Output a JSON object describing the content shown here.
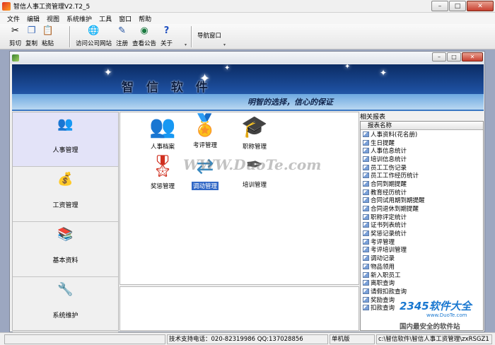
{
  "window": {
    "title": "智信人事工资管理V2.T2_5",
    "minimize": "–",
    "maximize": "□",
    "close": "✕"
  },
  "menu": [
    "文件",
    "编辑",
    "视图",
    "系统维护",
    "工具",
    "窗口",
    "帮助"
  ],
  "toolbar": {
    "cut": "剪切",
    "copy": "复制",
    "paste": "粘贴",
    "visit_site": "访问公司网站",
    "register": "注册",
    "notice": "查看公告",
    "about": "关于",
    "nav_window": "导航窗口"
  },
  "child_window": {
    "minimize": "–",
    "maximize": "□",
    "close": "✕"
  },
  "banner": {
    "brand": "智 信 软 件",
    "slogan": "明智的选择，信心的保证"
  },
  "leftnav": [
    "人事管理",
    "工资管理",
    "基本资料",
    "系统维护"
  ],
  "modules": [
    "人事档案",
    "考评管理",
    "职称管理",
    "奖惩管理",
    "调动管理",
    "培训管理"
  ],
  "watermark": "WWW.DuoTe.com",
  "reports": {
    "heading": "相关报表",
    "column": "报表名称",
    "items": [
      "人事资料(花名册)",
      "生日提醒",
      "人事信息统计",
      "培训信息统计",
      "员工工伤记录",
      "员工工作经历统计",
      "合同到期提醒",
      "教育经历统计",
      "合同试用期到期提醒",
      "合同退休到期提醒",
      "职称评定统计",
      "证书列表统计",
      "奖惩记录统计",
      "考评管理",
      "考评培训管理",
      "调动记录",
      "物品领用",
      "新入职员工",
      "离职查询",
      "请假扣款查询",
      "奖励查询",
      "扣款查询"
    ]
  },
  "corner_logo": {
    "big": "2345软件大全",
    "small": "www.DuoTe.com",
    "tag": "国内最安全的软件站"
  },
  "status": {
    "support": "技术支持电话：020-82319986 QQ:137028856",
    "mode": "单机版",
    "path": "c:\\智信软件\\智信人事工资管理\\zxRSGZ1"
  }
}
